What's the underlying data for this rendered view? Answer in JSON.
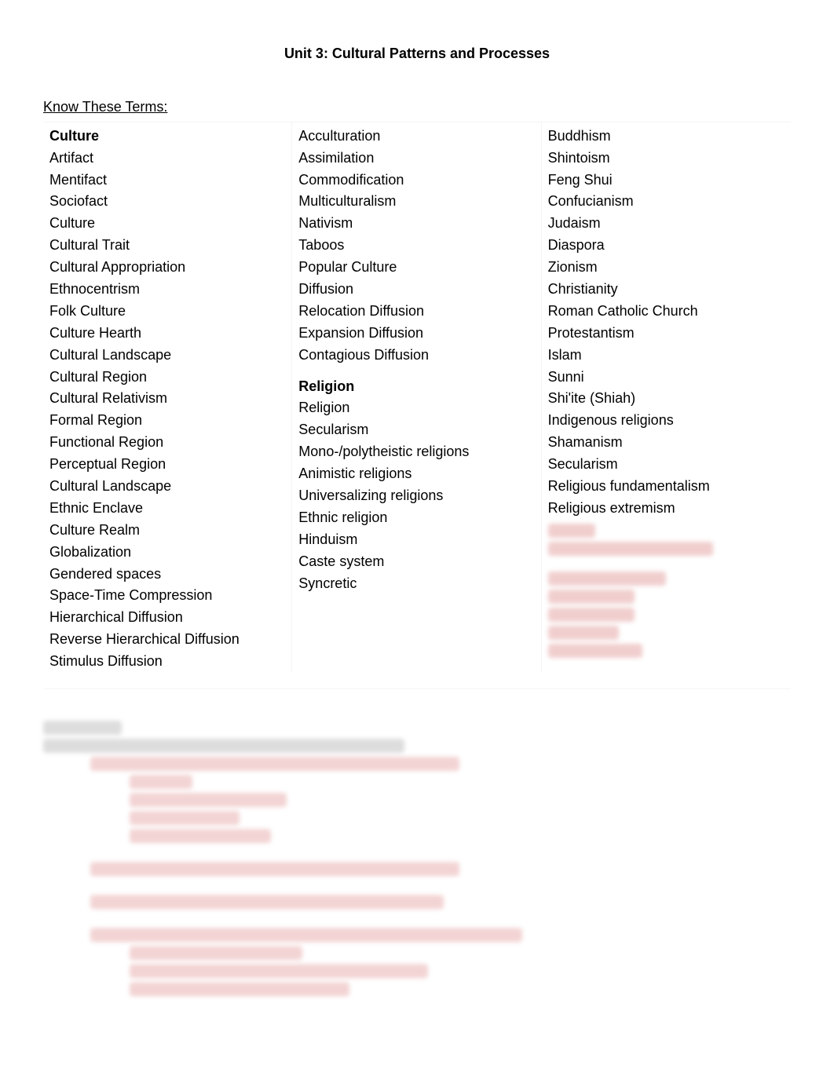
{
  "title": "Unit 3: Cultural Patterns and Processes",
  "subtitle": "Know These Terms:",
  "columns": [
    {
      "heading": "Culture",
      "terms": [
        "Artifact",
        "Mentifact",
        "Sociofact",
        "Culture",
        "Cultural Trait",
        "Cultural Appropriation",
        "Ethnocentrism",
        "Folk Culture",
        "Culture Hearth",
        "Cultural Landscape",
        "Cultural Region",
        "Cultural Relativism",
        "Formal Region",
        "Functional Region",
        "Perceptual Region",
        "Cultural Landscape",
        "Ethnic Enclave",
        "Culture Realm",
        "Globalization",
        "Gendered spaces",
        "Space-Time Compression",
        "Hierarchical Diffusion",
        "Reverse Hierarchical Diffusion",
        "Stimulus Diffusion"
      ]
    },
    {
      "top_terms": [
        "Acculturation",
        "Assimilation",
        "Commodification",
        "Multiculturalism",
        "Nativism",
        "Taboos",
        "Popular Culture",
        "Diffusion",
        "Relocation Diffusion",
        "Expansion Diffusion",
        "Contagious Diffusion"
      ],
      "heading": "Religion",
      "terms": [
        "Religion",
        "Secularism",
        "Mono-/polytheistic religions",
        "Animistic religions",
        "Universalizing religions",
        "Ethnic religion",
        "Hinduism",
        "Caste system",
        "Syncretic"
      ]
    },
    {
      "terms": [
        "Buddhism",
        "Shintoism",
        "Feng Shui",
        "Confucianism",
        "Judaism",
        "Diaspora",
        "Zionism",
        "Christianity",
        "Roman Catholic Church",
        "Protestantism",
        "Islam",
        "Sunni",
        "Shi'ite (Shiah)",
        "Indigenous religions",
        "Shamanism",
        "Secularism",
        "Religious fundamentalism",
        "Religious extremism"
      ]
    }
  ]
}
